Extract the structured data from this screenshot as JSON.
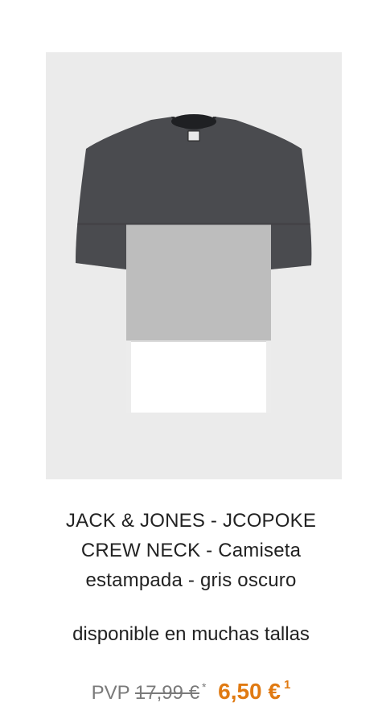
{
  "product": {
    "image_alt": "t-shirt-image",
    "title_line1": "JACK & JONES - JCOPOKE",
    "title_line2": "CREW NECK - Camiseta",
    "title_line3": "estampada - gris oscuro",
    "availability": "disponible en muchas tallas",
    "price": {
      "label": "PVP",
      "old": "17,99 €",
      "old_mark": "*",
      "new": "6,50 €",
      "new_mark": "1"
    }
  },
  "colors": {
    "image_background": "#ebebeb",
    "shirt_dark": "#4a4b4f",
    "shirt_light": "#bdbdbd",
    "shirt_white": "#ffffff",
    "sale_price": "#e07a12",
    "muted_text": "#7a7a7a"
  }
}
